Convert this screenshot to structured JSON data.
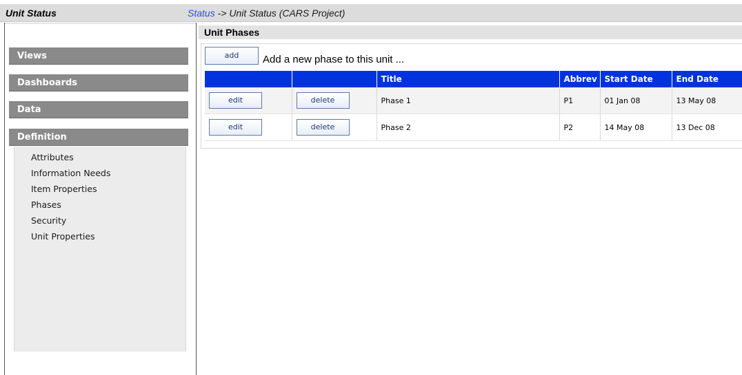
{
  "app": {
    "title": "Unit Status",
    "breadcrumb": {
      "link": "Status",
      "separator": "->",
      "current": "Unit Status (CARS Project)"
    }
  },
  "sidebar": {
    "headers": [
      "Views",
      "Dashboards",
      "Data",
      "Definition"
    ],
    "definition_items": [
      "Attributes",
      "Information Needs",
      "Item Properties",
      "Phases",
      "Security",
      "Unit Properties"
    ]
  },
  "main": {
    "section_title": "Unit Phases",
    "add_label": "add",
    "add_text": "Add a new phase to this unit ...",
    "table": {
      "columns": [
        "",
        "",
        "Title",
        "Abbrev",
        "Start Date",
        "End Date"
      ],
      "edit_label": "edit",
      "delete_label": "delete",
      "rows": [
        {
          "title": "Phase 1",
          "abbrev": "P1",
          "start": "01 Jan 08",
          "end": "13 May 08"
        },
        {
          "title": "Phase 2",
          "abbrev": "P2",
          "start": "14 May 08",
          "end": "13 Dec 08"
        }
      ]
    }
  },
  "colors": {
    "table_header": "#0033dd",
    "menu_header": "#8a8a8a",
    "link": "#2a4dd0"
  }
}
